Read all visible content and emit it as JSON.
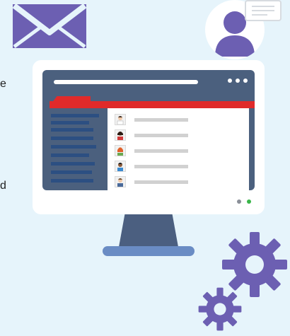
{
  "side_text": {
    "top": "e",
    "bottom": "d"
  },
  "colors": {
    "background": "#e6f4fb",
    "accent_purple": "#6c5fb2",
    "accent_red": "#e02a2a",
    "screen": "#4b607e",
    "status_gray": "#8a8f98",
    "status_green": "#3ab54a"
  },
  "icons": {
    "envelope": "envelope-icon",
    "avatar": "user-avatar-icon",
    "chat": "chat-bubble-icon",
    "gear_large": "gear-icon",
    "gear_small": "gear-icon"
  }
}
